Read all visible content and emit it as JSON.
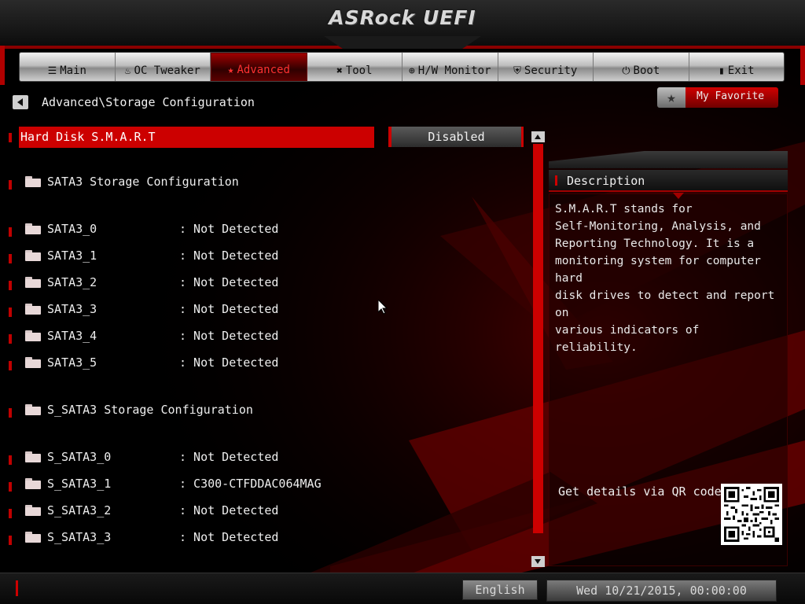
{
  "header": {
    "title": "ASRock UEFI"
  },
  "nav": {
    "items": [
      {
        "label": "Main",
        "icon": "list-icon",
        "glyph": "☰",
        "active": false
      },
      {
        "label": "OC Tweaker",
        "icon": "flame-icon",
        "glyph": "♨",
        "active": false
      },
      {
        "label": "Advanced",
        "icon": "star-icon",
        "glyph": "★",
        "active": true
      },
      {
        "label": "Tool",
        "icon": "tool-icon",
        "glyph": "✖",
        "active": false
      },
      {
        "label": "H/W Monitor",
        "icon": "monitor-icon",
        "glyph": "⊕",
        "active": false
      },
      {
        "label": "Security",
        "icon": "shield-icon",
        "glyph": "⛨",
        "active": false
      },
      {
        "label": "Boot",
        "icon": "power-icon",
        "glyph": "⏻",
        "active": false
      },
      {
        "label": "Exit",
        "icon": "exit-icon",
        "glyph": "▮",
        "active": false
      }
    ]
  },
  "breadcrumb": "Advanced\\Storage Configuration",
  "favorite": {
    "label": "My Favorite"
  },
  "settings": {
    "smart": {
      "label": "Hard Disk S.M.A.R.T",
      "value": "Disabled"
    },
    "sata3_header": "SATA3 Storage Configuration",
    "sata3": [
      {
        "label": "SATA3_0",
        "value": ": Not Detected"
      },
      {
        "label": "SATA3_1",
        "value": ": Not Detected"
      },
      {
        "label": "SATA3_2",
        "value": ": Not Detected"
      },
      {
        "label": "SATA3_3",
        "value": ": Not Detected"
      },
      {
        "label": "SATA3_4",
        "value": ": Not Detected"
      },
      {
        "label": "SATA3_5",
        "value": ": Not Detected"
      }
    ],
    "s_sata3_header": "S_SATA3 Storage Configuration",
    "s_sata3": [
      {
        "label": "S_SATA3_0",
        "value": ": Not Detected"
      },
      {
        "label": "S_SATA3_1",
        "value": ": C300-CTFDDAC064MAG"
      },
      {
        "label": "S_SATA3_2",
        "value": ": Not Detected"
      },
      {
        "label": "S_SATA3_3",
        "value": ": Not Detected"
      }
    ]
  },
  "description": {
    "title": "Description",
    "lines": [
      "S.M.A.R.T stands for",
      "Self-Monitoring, Analysis, and",
      "Reporting Technology. It is a",
      "monitoring system for computer hard",
      "disk drives to detect and report on",
      "various indicators of reliability."
    ],
    "qr_label": "Get details via QR code"
  },
  "footer": {
    "language": "English",
    "datetime": "Wed 10/21/2015, 00:00:00"
  },
  "colors": {
    "accent": "#cc0000",
    "background": "#000000",
    "text": "#e8e8e8"
  }
}
